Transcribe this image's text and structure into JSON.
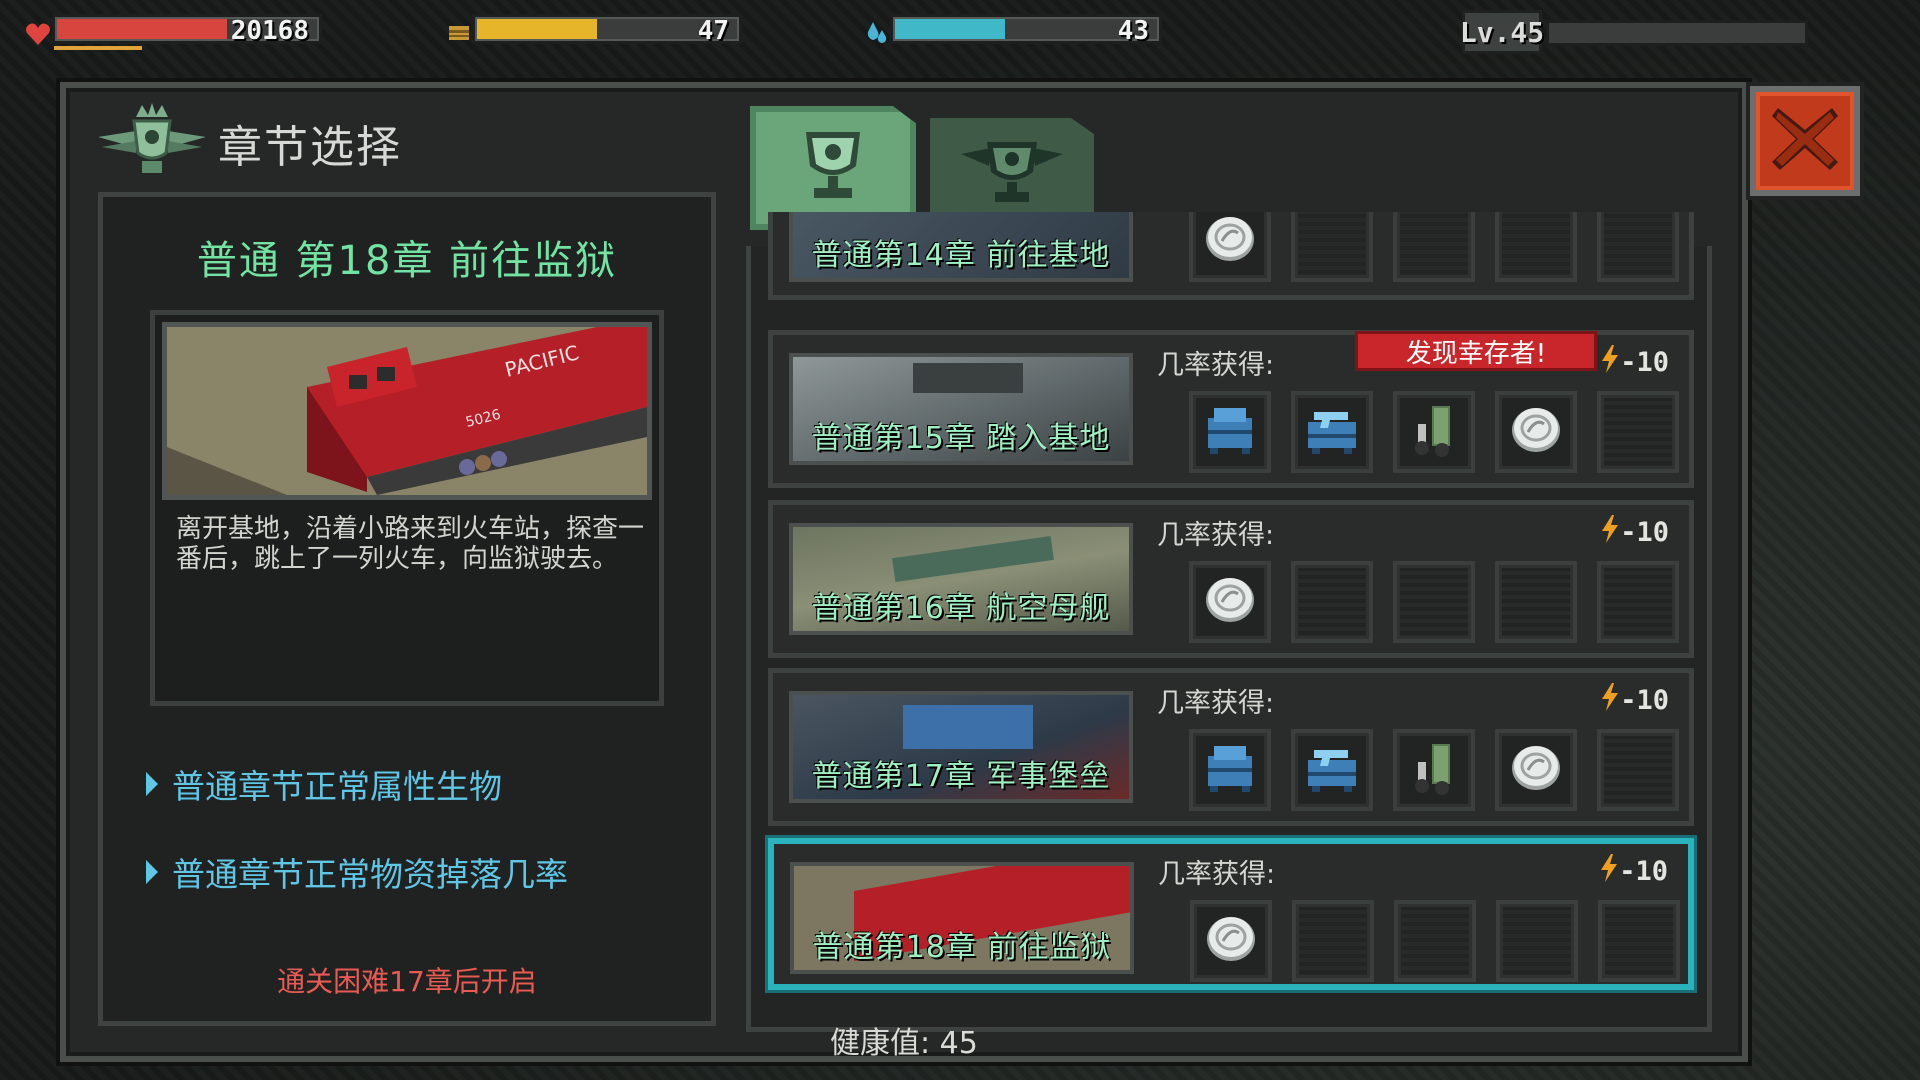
{
  "hud": {
    "hp": {
      "value": "20168",
      "fraction": 0.66,
      "color": "#d8443e"
    },
    "food": {
      "value": "47",
      "fraction": 0.47,
      "color": "#e6b52a"
    },
    "water": {
      "value": "43",
      "fraction": 0.43,
      "color": "#41b8c8"
    },
    "level": {
      "label": "Lv.45",
      "fraction": 0.0
    }
  },
  "panel": {
    "title": "章节选择"
  },
  "selected_chapter": {
    "title": "普通 第18章 前往监狱",
    "description": "离开基地，沿着小路来到火车站，探查一番后，跳上了一列火车，向监狱驶去。",
    "links": [
      "普通章节正常属性生物",
      "普通章节正常物资掉落几率"
    ],
    "unlock_hint": "通关困难17章后开启"
  },
  "tabs": [
    {
      "name": "normal-trophy-tab",
      "active": true
    },
    {
      "name": "hard-winged-trophy-tab",
      "active": false
    }
  ],
  "chapters": [
    {
      "label": "普通第14章 前往基地",
      "odds_label": "",
      "energy": "",
      "badge": "",
      "selected": false,
      "slots": [
        "coin",
        "empty",
        "empty",
        "empty",
        "empty"
      ]
    },
    {
      "label": "普通第15章 踏入基地",
      "odds_label": "几率获得:",
      "energy": "-10",
      "badge": "发现幸存者!",
      "selected": false,
      "slots": [
        "toolbox",
        "gun-case",
        "bullets",
        "coin",
        "empty"
      ]
    },
    {
      "label": "普通第16章 航空母舰",
      "odds_label": "几率获得:",
      "energy": "-10",
      "badge": "",
      "selected": false,
      "slots": [
        "coin",
        "empty",
        "empty",
        "empty",
        "empty"
      ]
    },
    {
      "label": "普通第17章 军事堡垒",
      "odds_label": "几率获得:",
      "energy": "-10",
      "badge": "",
      "selected": false,
      "slots": [
        "toolbox",
        "gun-case",
        "bullets",
        "coin",
        "empty"
      ]
    },
    {
      "label": "普通第18章 前往监狱",
      "odds_label": "几率获得:",
      "energy": "-10",
      "badge": "",
      "selected": true,
      "slots": [
        "coin",
        "empty",
        "empty",
        "empty",
        "empty"
      ]
    }
  ],
  "footer": {
    "health": "健康值: 45"
  },
  "colors": {
    "accent_green": "#72e3a2",
    "link_blue": "#5fc6e6",
    "warning_red": "#e85a52",
    "select_cyan": "#2ab3bd",
    "close_red": "#c23a1c"
  }
}
